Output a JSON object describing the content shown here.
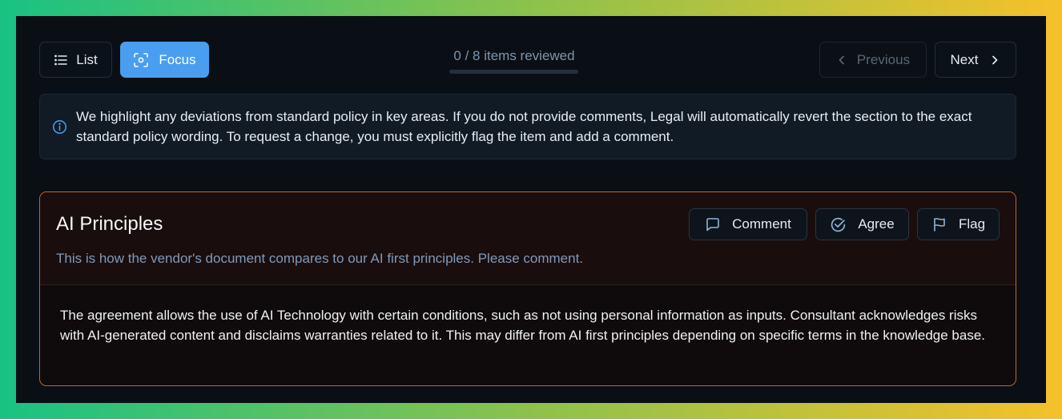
{
  "toolbar": {
    "list_label": "List",
    "focus_label": "Focus",
    "previous_label": "Previous",
    "next_label": "Next"
  },
  "progress": {
    "text": "0 / 8 items reviewed",
    "reviewed": 0,
    "total": 8
  },
  "info": {
    "text": "We highlight any deviations from standard policy in key areas. If you do not provide comments, Legal will automatically revert the section to the exact standard policy wording. To request a change, you must explicitly flag the item and add a comment."
  },
  "card": {
    "title": "AI Principles",
    "subtitle": "This is how the vendor's document compares to our AI first principles. Please comment.",
    "comment_label": "Comment",
    "agree_label": "Agree",
    "flag_label": "Flag",
    "body": "The agreement allows the use of AI Technology with certain conditions, such as not using personal information as inputs. Consultant acknowledges risks with AI-generated content and disclaims warranties related to it. This may differ from AI first principles depending on specific terms in the knowledge base."
  },
  "colors": {
    "accent": "#4a9ef0",
    "card_border": "#c4642a",
    "background": "#0a0f16"
  },
  "icons": {
    "list": "list-icon",
    "focus": "focus-icon",
    "previous": "chevron-left-icon",
    "next": "chevron-right-icon",
    "info": "info-icon",
    "comment": "message-square-icon",
    "agree": "check-circle-icon",
    "flag": "flag-icon"
  }
}
